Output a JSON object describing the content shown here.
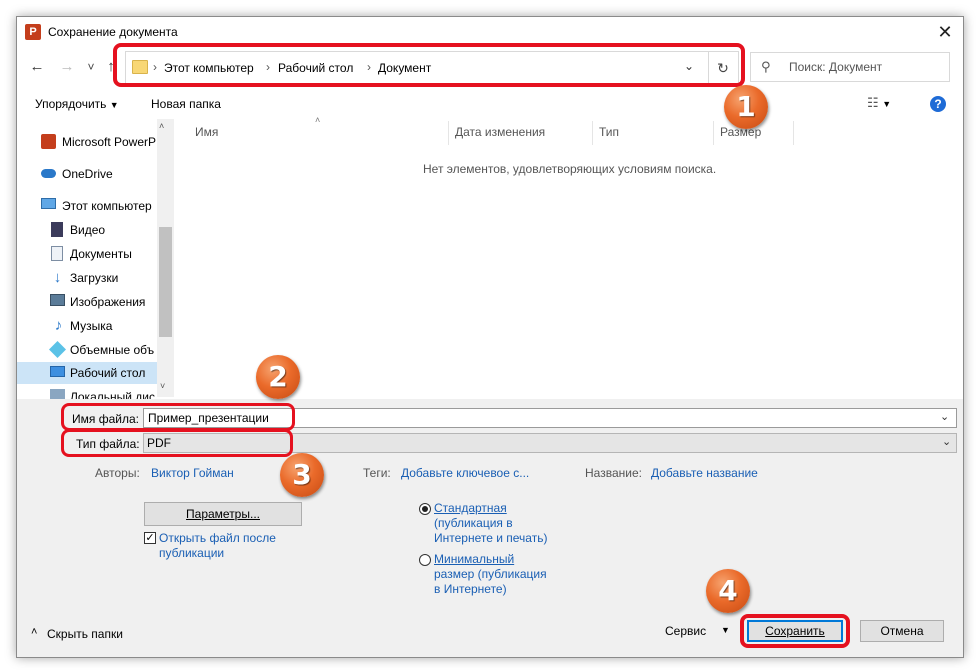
{
  "window": {
    "title": "Сохранение документа",
    "app_icon": "powerpoint-icon",
    "close_glyph": "✕"
  },
  "nav": {
    "back": "←",
    "forward": "→",
    "recent": "˅",
    "up": "↑"
  },
  "address": {
    "crumbs": [
      "Этот компьютер",
      "Рабочий стол",
      "Документ"
    ],
    "separator": "›",
    "dropdown": "⌄",
    "refresh": "↻"
  },
  "search": {
    "placeholder": "Поиск: Документ",
    "icon": "search-icon"
  },
  "toolbar": {
    "organize": "Упорядочить",
    "new_folder": "Новая папка",
    "view_icon": "view-options-icon",
    "help": "?"
  },
  "sidebar": {
    "items": [
      {
        "label": "Microsoft PowerP",
        "icon": "powerpoint-icon"
      },
      {
        "label": "OneDrive",
        "icon": "cloud-icon"
      },
      {
        "label": "Этот компьютер",
        "icon": "computer-icon"
      },
      {
        "label": "Видео",
        "icon": "video-icon"
      },
      {
        "label": "Документы",
        "icon": "documents-icon"
      },
      {
        "label": "Загрузки",
        "icon": "downloads-icon"
      },
      {
        "label": "Изображения",
        "icon": "pictures-icon"
      },
      {
        "label": "Музыка",
        "icon": "music-icon"
      },
      {
        "label": "Объемные объ",
        "icon": "3d-objects-icon"
      },
      {
        "label": "Рабочий стол",
        "icon": "desktop-icon"
      },
      {
        "label": "Локальный дис",
        "icon": "disk-icon"
      }
    ],
    "selected": "Рабочий стол"
  },
  "columns": [
    "Имя",
    "Дата изменения",
    "Тип",
    "Размер"
  ],
  "empty_message": "Нет элементов, удовлетворяющих условиям поиска.",
  "form": {
    "filename_label": "Имя файла:",
    "filename_value": "Пример_презентации",
    "filetype_label": "Тип файла:",
    "filetype_value": "PDF"
  },
  "meta": {
    "authors_label": "Авторы:",
    "authors_value": "Виктор Гойман",
    "tags_label": "Теги:",
    "tags_value": "Добавьте ключевое с...",
    "title_label": "Название:",
    "title_value": "Добавьте название"
  },
  "options": {
    "params_button": "Параметры...",
    "open_after_publish": "Открыть файл после публикации",
    "open_after_publish_line1": "Открыть файл после",
    "open_after_publish_line2": "публикации",
    "open_after_publish_checked": true,
    "radio_standard_lines": [
      "Стандартная",
      "(публикация в",
      "Интернете и печать)"
    ],
    "radio_standard_selected": true,
    "radio_minimal_lines": [
      "Минимальный",
      "размер (публикация",
      "в Интернете)"
    ],
    "radio_minimal_selected": false
  },
  "footer": {
    "hide_folders": "Скрыть папки",
    "tools": "Сервис",
    "save": "Сохранить",
    "cancel": "Отмена"
  },
  "callouts": [
    "1",
    "2",
    "3",
    "4"
  ],
  "colors": {
    "highlight": "#e5111f",
    "badge": "#ea6a2a",
    "link": "#1a5fb4",
    "selection": "#cce4f7"
  }
}
